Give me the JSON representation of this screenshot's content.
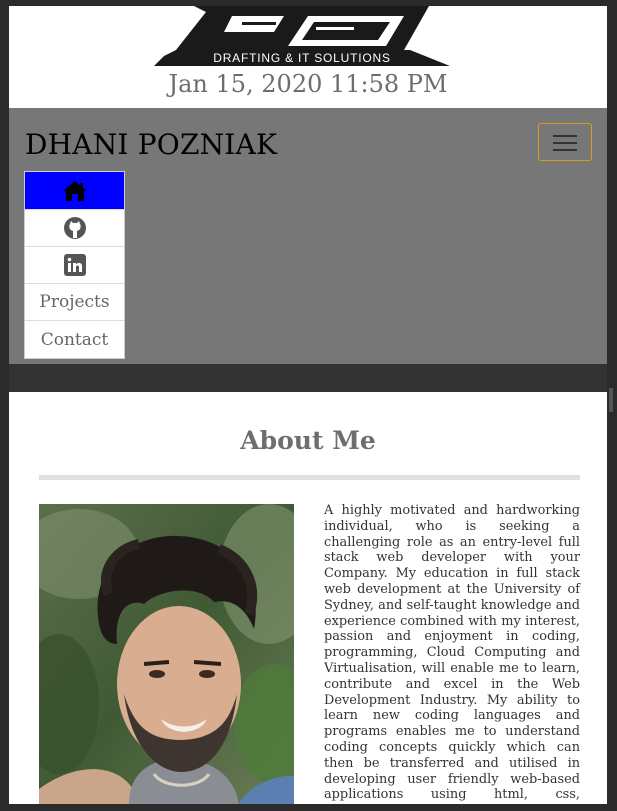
{
  "header": {
    "logo_text": "DRAFTING & IT SOLUTIONS",
    "datetime": "Jan 15, 2020 11:58 PM"
  },
  "navbar": {
    "brand": "DHANI POZNIAK",
    "toggler_icon": "hamburger-icon",
    "items": [
      {
        "type": "icon",
        "icon": "home-icon",
        "active": true
      },
      {
        "type": "icon",
        "icon": "github-icon",
        "active": false
      },
      {
        "type": "icon",
        "icon": "linkedin-icon",
        "active": false
      },
      {
        "type": "text",
        "label": "Projects",
        "active": false
      },
      {
        "type": "text",
        "label": "Contact",
        "active": false
      }
    ],
    "colors": {
      "navbar_bg": "#777777",
      "active_bg": "#0000ff",
      "toggler_border": "#d4a017"
    }
  },
  "about": {
    "title": "About Me",
    "bio": "A highly motivated and hardworking individual, who is seeking a challenging role as an entry-level full stack web developer with your Company. My education in full stack web development at the University of Sydney, and self-taught knowledge and experience combined with my interest, passion and enjoyment in coding, programming, Cloud Computing and Virtualisation, will enable me to learn, contribute and excel in the Web Development Industry. My ability to learn new coding languages and programs enables me to understand coding concepts quickly which can then be transferred and utilised in developing user friendly web-based applications using html, css, javaScript, bootstrap, jQuery, API's and many more coding"
  }
}
